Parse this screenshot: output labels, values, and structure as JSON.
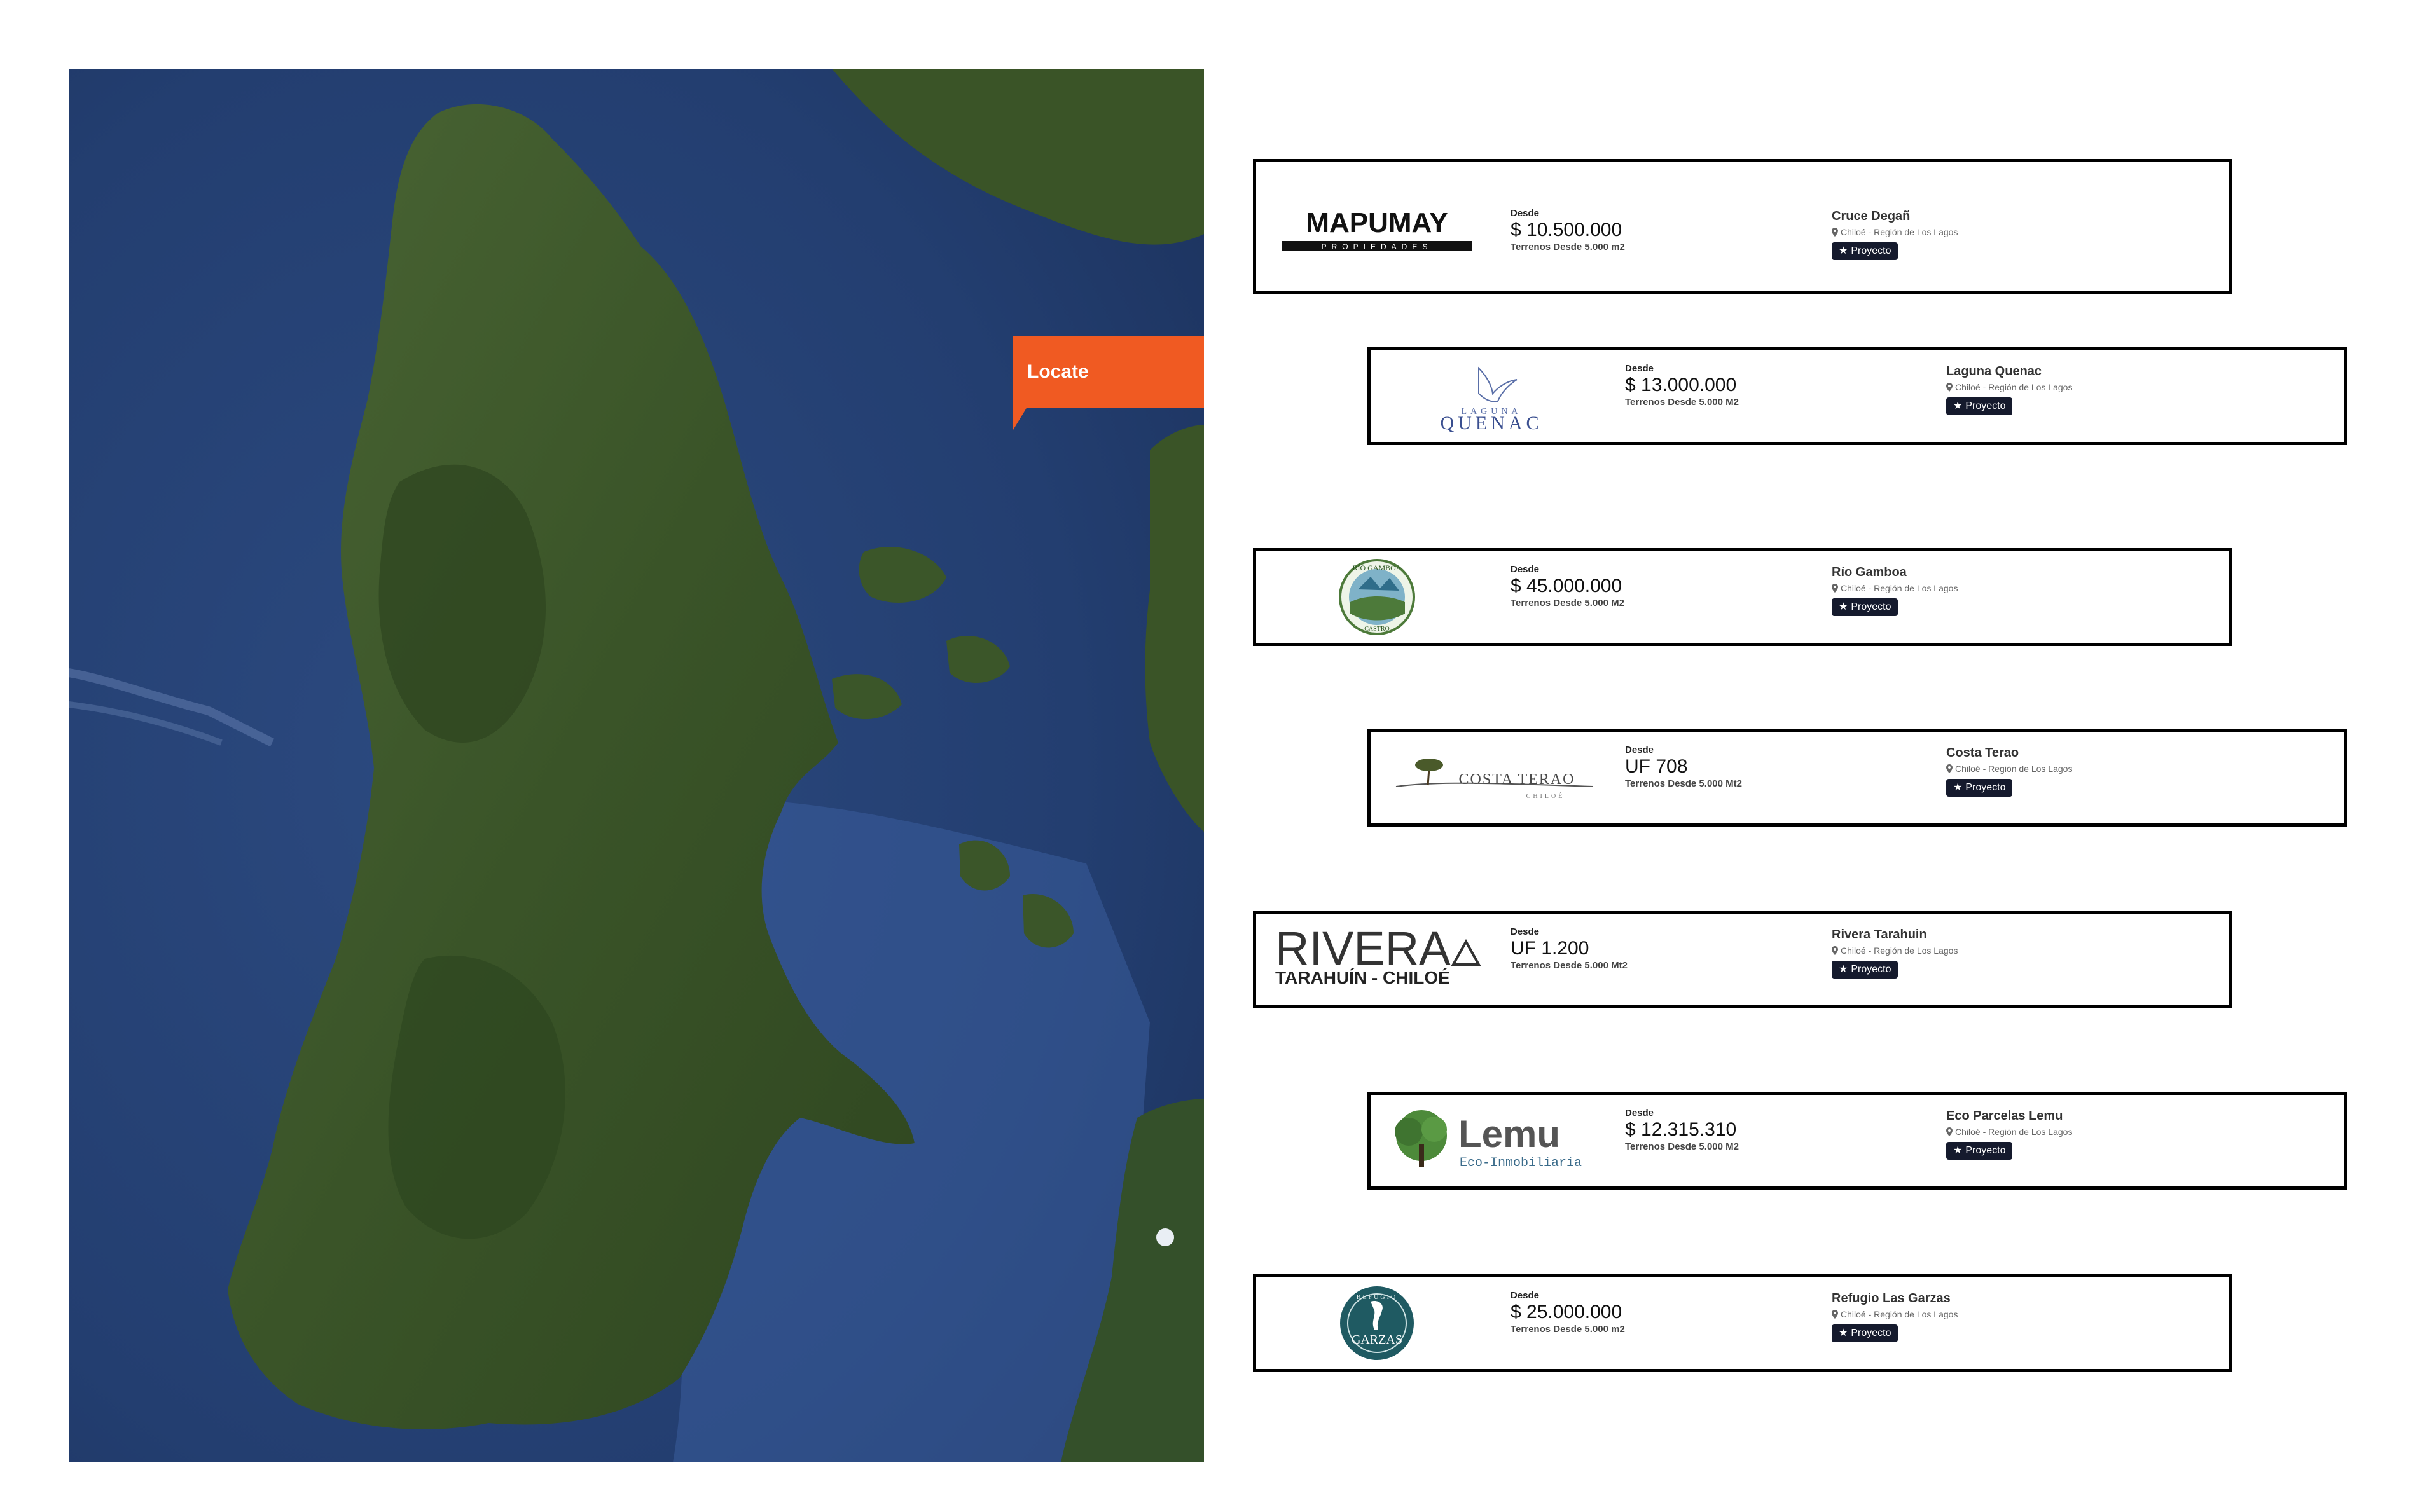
{
  "map": {
    "locate_label": "Locate"
  },
  "listings": [
    {
      "from_label": "Desde",
      "price": "$ 10.500.000",
      "terrain": "Terrenos Desde 5.000 m2",
      "name": "Cruce Degañ",
      "location": "Chiloé - Región de Los Lagos",
      "badge": "Proyecto",
      "logo": {
        "primary": "MAPUMAY",
        "secondary": "PROPIEDADES"
      }
    },
    {
      "from_label": "Desde",
      "price": "$ 13.000.000",
      "terrain": "Terrenos Desde 5.000 M2",
      "name": "Laguna Quenac",
      "location": "Chiloé - Región de Los Lagos",
      "badge": "Proyecto",
      "logo": {
        "primary": "QUENAC",
        "secondary": "LAGUNA"
      }
    },
    {
      "from_label": "Desde",
      "price": "$ 45.000.000",
      "terrain": "Terrenos Desde 5.000 M2",
      "name": "Río Gamboa",
      "location": "Chiloé - Región de Los Lagos",
      "badge": "Proyecto",
      "logo": {
        "primary": "RÍO GAMBOA",
        "secondary": "CASTRO"
      }
    },
    {
      "from_label": "Desde",
      "price": "UF 708",
      "terrain": "Terrenos Desde 5.000 Mt2",
      "name": "Costa Terao",
      "location": "Chiloé - Región de Los Lagos",
      "badge": "Proyecto",
      "logo": {
        "primary": "COSTA TERAO",
        "secondary": "CHILOÉ"
      }
    },
    {
      "from_label": "Desde",
      "price": "UF 1.200",
      "terrain": "Terrenos Desde 5.000 Mt2",
      "name": "Rivera Tarahuin",
      "location": "Chiloé - Región de Los Lagos",
      "badge": "Proyecto",
      "logo": {
        "primary": "RIVERA",
        "secondary": "TARAHUÍN - CHILOÉ"
      }
    },
    {
      "from_label": "Desde",
      "price": "$ 12.315.310",
      "terrain": "Terrenos Desde 5.000 M2",
      "name": "Eco Parcelas Lemu",
      "location": "Chiloé - Región de Los Lagos",
      "badge": "Proyecto",
      "logo": {
        "primary": "Lemu",
        "secondary": "Eco-Inmobiliaria"
      }
    },
    {
      "from_label": "Desde",
      "price": "$ 25.000.000",
      "terrain": "Terrenos Desde 5.000 m2",
      "name": "Refugio Las Garzas",
      "location": "Chiloé - Región de Los Lagos",
      "badge": "Proyecto",
      "logo": {
        "primary": "GARZAS",
        "secondary": "REFUGIO"
      }
    }
  ],
  "colors": {
    "accent": "#f05a22",
    "badge_bg": "#151a2d",
    "ocean": "#1f3a66",
    "land": "#3e5a2c"
  }
}
